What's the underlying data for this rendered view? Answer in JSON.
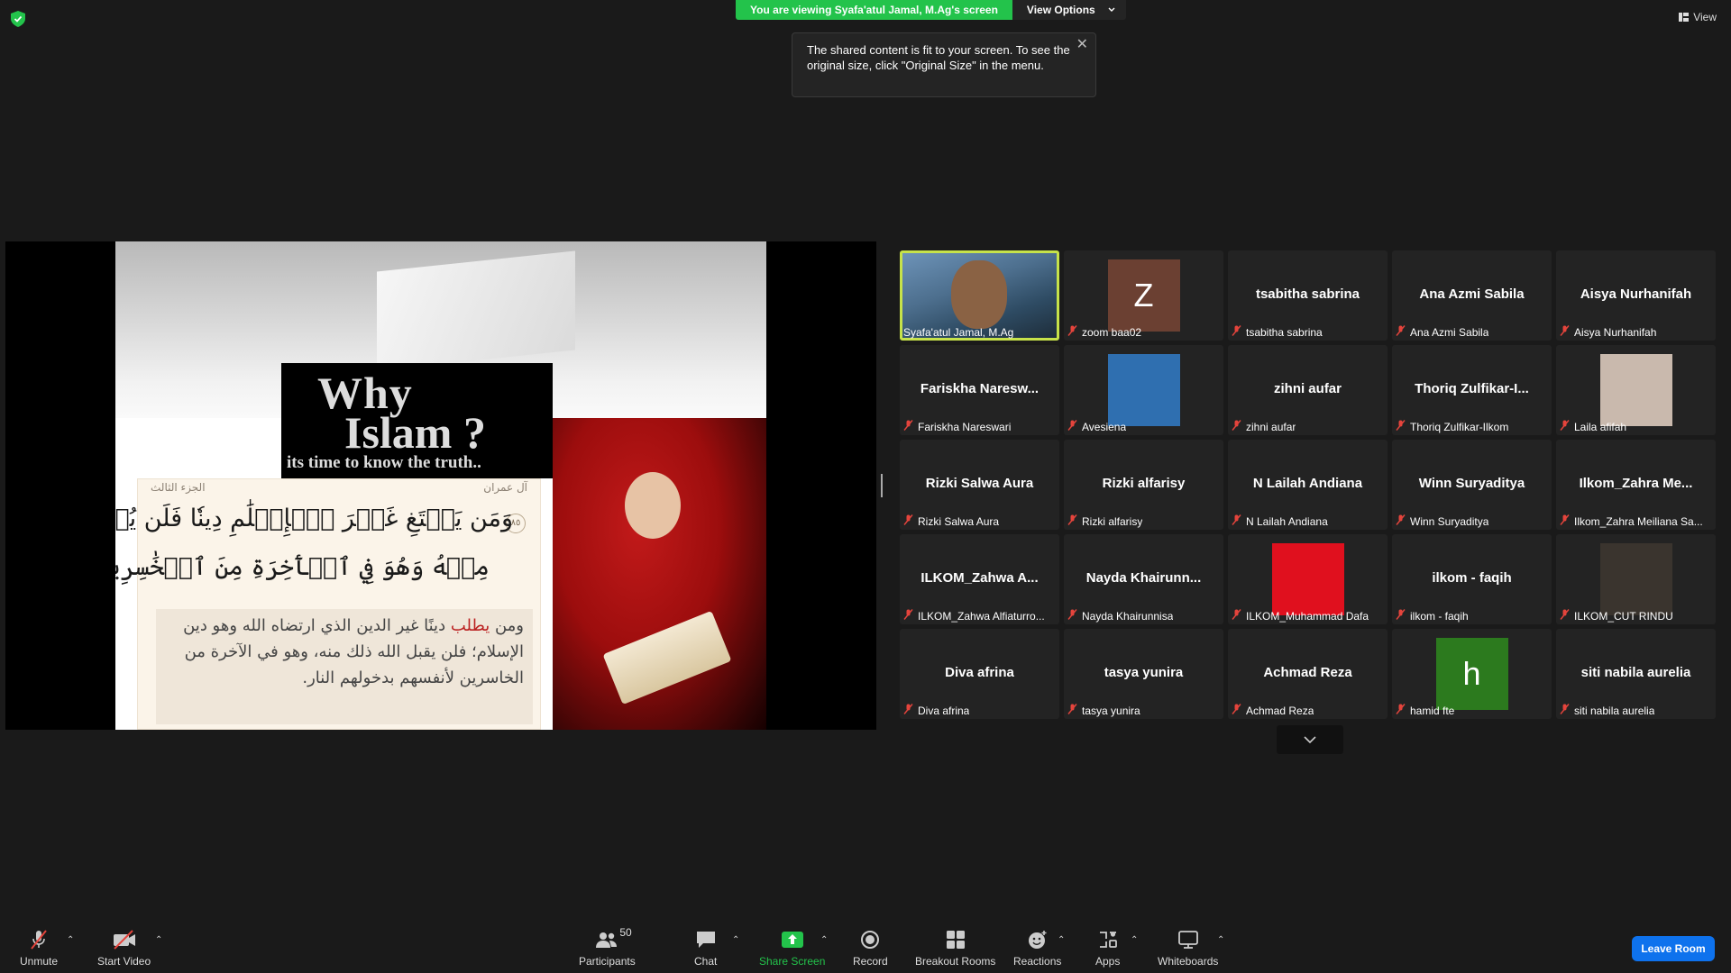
{
  "top": {
    "viewing_text": "You are viewing Syafa'atul Jamal, M.Ag's screen",
    "view_options": "View Options",
    "view_label": "View",
    "tooltip": "The shared content is fit to your screen. To see the original size, click \"Original Size\" in the menu."
  },
  "slide": {
    "title1": "Why",
    "title2": "Islam ?",
    "subtitle": "its time to know the truth..",
    "juz": "الجزء الثالث",
    "surah": "آل عمران",
    "ayah_number": "٨٥",
    "verse_line1": "وَمَن يَبۡتَغِ غَيۡرَ ٱلۡإِسۡلَٰمِ دِينٗا فَلَن يُقۡبَلَ",
    "verse_line2": "مِنۡهُ وَهُوَ فِي ٱلۡأٓخِرَةِ مِنَ ٱلۡخَٰسِرِينَ",
    "tafsir_pre": "ومن ",
    "tafsir_red": "يطلب",
    "tafsir_post": " دينًا غير الدين الذي ارتضاه الله وهو دين الإسلام؛ فلن يقبل الله ذلك منه، وهو في الآخرة من الخاسرين لأنفسهم بدخولهم النار."
  },
  "participants": [
    {
      "big": "",
      "label": "Syafa'atul Jamal, M.Ag",
      "type": "video",
      "muted": false
    },
    {
      "big": "Z",
      "label": "zoom baa02",
      "type": "letter",
      "color": "#6b4032",
      "muted": true
    },
    {
      "big": "tsabitha sabrina",
      "label": "tsabitha sabrina",
      "type": "name",
      "muted": true
    },
    {
      "big": "Ana Azmi Sabila",
      "label": "Ana Azmi Sabila",
      "type": "name",
      "muted": true
    },
    {
      "big": "Aisya Nurhanifah",
      "label": "Aisya Nurhanifah",
      "type": "name",
      "muted": true
    },
    {
      "big": "Fariskha Naresw...",
      "label": "Fariskha Nareswari",
      "type": "name",
      "muted": true
    },
    {
      "big": "",
      "label": "Avesiena",
      "type": "photo",
      "color": "#2f6fb0",
      "muted": true
    },
    {
      "big": "zihni aufar",
      "label": "zihni aufar",
      "type": "name",
      "muted": true
    },
    {
      "big": "Thoriq  Zulfikar-I...",
      "label": "Thoriq Zulfikar-Ilkom",
      "type": "name",
      "muted": true
    },
    {
      "big": "",
      "label": "Laila afifah",
      "type": "photo",
      "color": "#c9b9ad",
      "muted": true
    },
    {
      "big": "Rizki Salwa Aura",
      "label": "Rizki Salwa Aura",
      "type": "name",
      "muted": true
    },
    {
      "big": "Rizki alfarisy",
      "label": "Rizki alfarisy",
      "type": "name",
      "muted": true
    },
    {
      "big": "N Lailah Andiana",
      "label": "N Lailah Andiana",
      "type": "name",
      "muted": true
    },
    {
      "big": "Winn Suryaditya",
      "label": "Winn Suryaditya",
      "type": "name",
      "muted": true
    },
    {
      "big": "Ilkom_Zahra  Me...",
      "label": "Ilkom_Zahra Meiliana Sa...",
      "type": "name",
      "muted": true
    },
    {
      "big": "ILKOM_Zahwa  A...",
      "label": "ILKOM_Zahwa Alfiaturro...",
      "type": "name",
      "muted": true
    },
    {
      "big": "Nayda  Khairunn...",
      "label": "Nayda Khairunnisa",
      "type": "name",
      "muted": true
    },
    {
      "big": "",
      "label": "ILKOM_Muhammad Dafa",
      "type": "photo",
      "color": "#e0101e",
      "muted": true
    },
    {
      "big": "ilkom - faqih",
      "label": "ilkom - faqih",
      "type": "name",
      "muted": true
    },
    {
      "big": "",
      "label": "ILKOM_CUT RINDU",
      "type": "photo",
      "color": "#3a342e",
      "muted": true
    },
    {
      "big": "Diva afrina",
      "label": "Diva afrina",
      "type": "name",
      "muted": true
    },
    {
      "big": "tasya yunira",
      "label": "tasya yunira",
      "type": "name",
      "muted": true
    },
    {
      "big": "Achmad Reza",
      "label": "Achmad Reza",
      "type": "name",
      "muted": true
    },
    {
      "big": "h",
      "label": "hamid fte",
      "type": "letter",
      "color": "#2c7a1e",
      "muted": true
    },
    {
      "big": "siti nabila aurelia",
      "label": "siti nabila aurelia",
      "type": "name",
      "muted": true
    }
  ],
  "toolbar": {
    "unmute": "Unmute",
    "start_video": "Start Video",
    "participants": "Participants",
    "participants_count": "50",
    "chat": "Chat",
    "share_screen": "Share Screen",
    "record": "Record",
    "breakout": "Breakout Rooms",
    "reactions": "Reactions",
    "apps": "Apps",
    "whiteboards": "Whiteboards",
    "leave": "Leave Room"
  },
  "colors": {
    "share_green": "#23c34b",
    "active_speaker": "#c6e24a",
    "mute_red": "#e5443c",
    "leave_blue": "#0e72ed"
  }
}
